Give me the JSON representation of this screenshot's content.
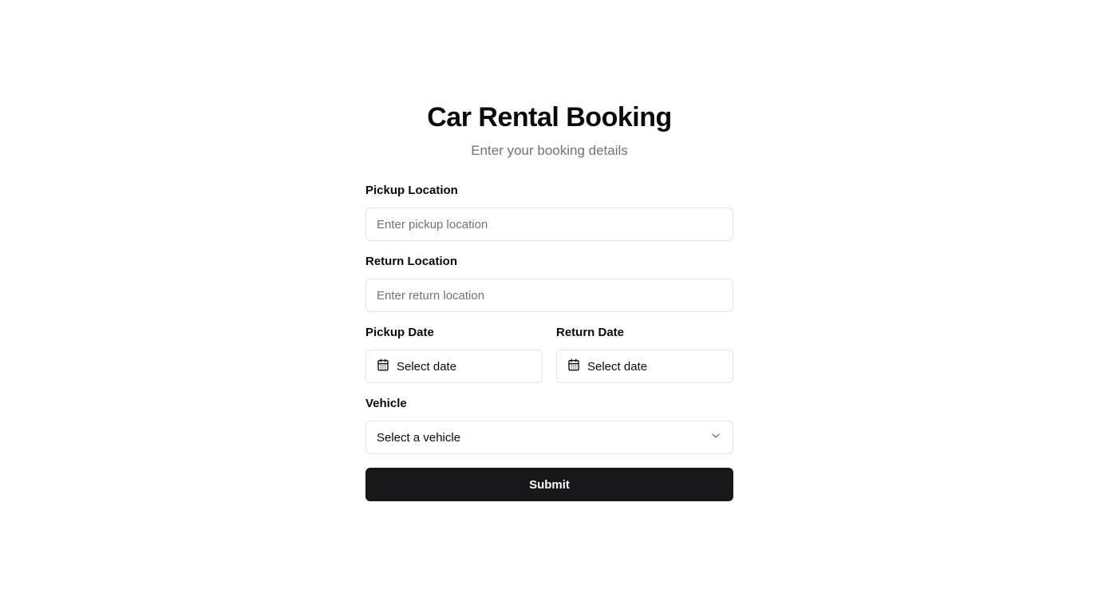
{
  "header": {
    "title": "Car Rental Booking",
    "subtitle": "Enter your booking details"
  },
  "pickup_location": {
    "label": "Pickup Location",
    "value": "",
    "placeholder": "Enter pickup location"
  },
  "return_location": {
    "label": "Return Location",
    "value": "",
    "placeholder": "Enter return location"
  },
  "pickup_date": {
    "label": "Pickup Date",
    "value": "Select date",
    "icon": "calendar-icon"
  },
  "return_date": {
    "label": "Return Date",
    "value": "Select date",
    "icon": "calendar-icon"
  },
  "vehicle": {
    "label": "Vehicle",
    "selected": "Select a vehicle",
    "icon": "chevron-down-icon"
  },
  "submit": {
    "label": "Submit"
  },
  "colors": {
    "primary_button": "#18181b",
    "border": "#e4e4e7",
    "muted_text": "#6b7280"
  }
}
